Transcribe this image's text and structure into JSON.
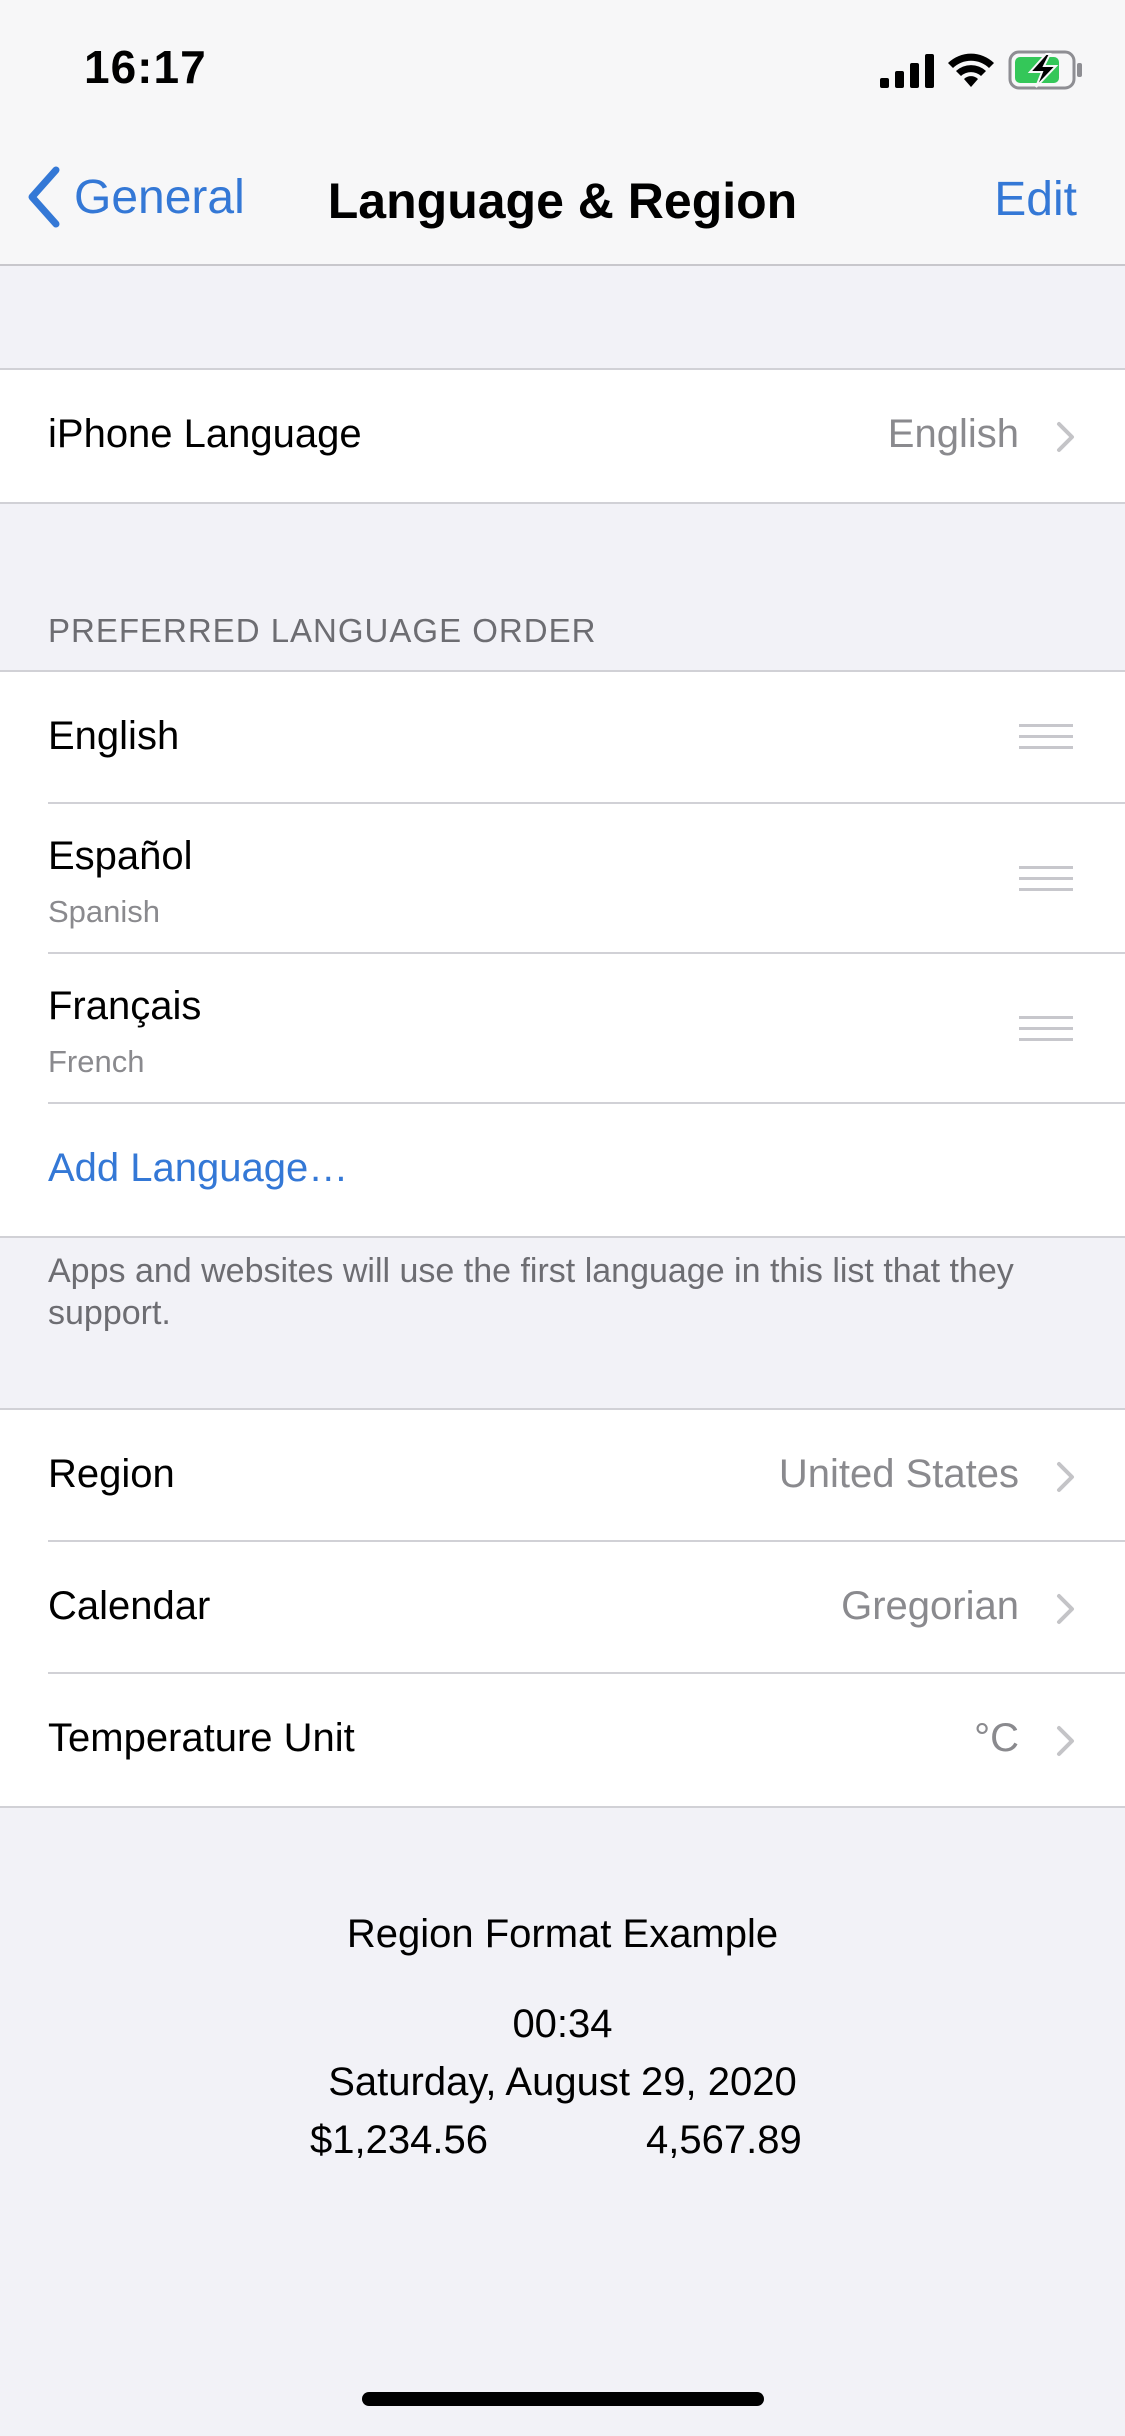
{
  "status_bar": {
    "time": "16:17"
  },
  "nav": {
    "back_label": "General",
    "title": "Language & Region",
    "edit_label": "Edit"
  },
  "iphone_language": {
    "label": "iPhone Language",
    "value": "English"
  },
  "preferred": {
    "header": "PREFERRED LANGUAGE ORDER",
    "languages": [
      {
        "name": "English",
        "sub": ""
      },
      {
        "name": "Español",
        "sub": "Spanish"
      },
      {
        "name": "Français",
        "sub": "French"
      }
    ],
    "add_label": "Add Language…",
    "footer": "Apps and websites will use the first language in this list that they support."
  },
  "region_settings": [
    {
      "label": "Region",
      "value": "United States"
    },
    {
      "label": "Calendar",
      "value": "Gregorian"
    },
    {
      "label": "Temperature Unit",
      "value": "°C"
    }
  ],
  "format_example": {
    "title": "Region Format Example",
    "time": "00:34",
    "date": "Saturday, August 29, 2020",
    "currency": "$1,234.56",
    "number": "4,567.89"
  },
  "colors": {
    "accent": "#3478d6",
    "battery_charge": "#34c759"
  }
}
